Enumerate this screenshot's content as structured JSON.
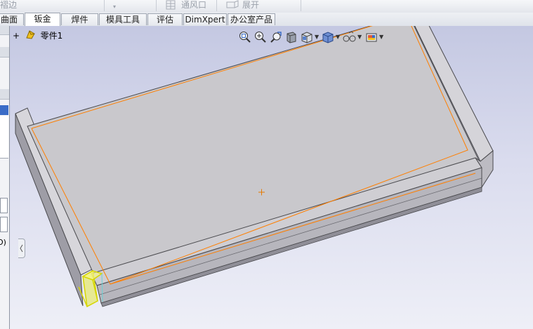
{
  "toolbar": {
    "items": [
      {
        "label": "褶边"
      },
      {
        "label": "▾"
      },
      {
        "label": "通风口"
      },
      {
        "label": "展开"
      }
    ]
  },
  "tabs": [
    {
      "label": "曲面",
      "active": false
    },
    {
      "label": "钣金",
      "active": true
    },
    {
      "label": "焊件",
      "active": false
    },
    {
      "label": "模具工具",
      "active": false
    },
    {
      "label": "评估",
      "active": false
    },
    {
      "label": "DimXpert",
      "active": false
    },
    {
      "label": "办公室产品",
      "active": false
    }
  ],
  "tree": {
    "expander": "+",
    "part_label": "零件1"
  },
  "left_panel": {
    "cutoff_text": "O)"
  },
  "headsup_toolbar": {
    "icons": [
      "zoom-to-fit-icon",
      "zoom-to-area-icon",
      "previous-view-icon",
      "section-view-icon",
      "view-orientation-icon",
      "display-style-icon",
      "hide-show-items-icon",
      "edit-appearance-icon"
    ]
  },
  "colors": {
    "viewport_top": "#c4c8e2",
    "viewport_bottom": "#eeeff7",
    "model_face": "#c9c8cc",
    "edge_highlight": "#ff7f00",
    "selection": "#ffff00",
    "accent": "#3a6cc7"
  }
}
